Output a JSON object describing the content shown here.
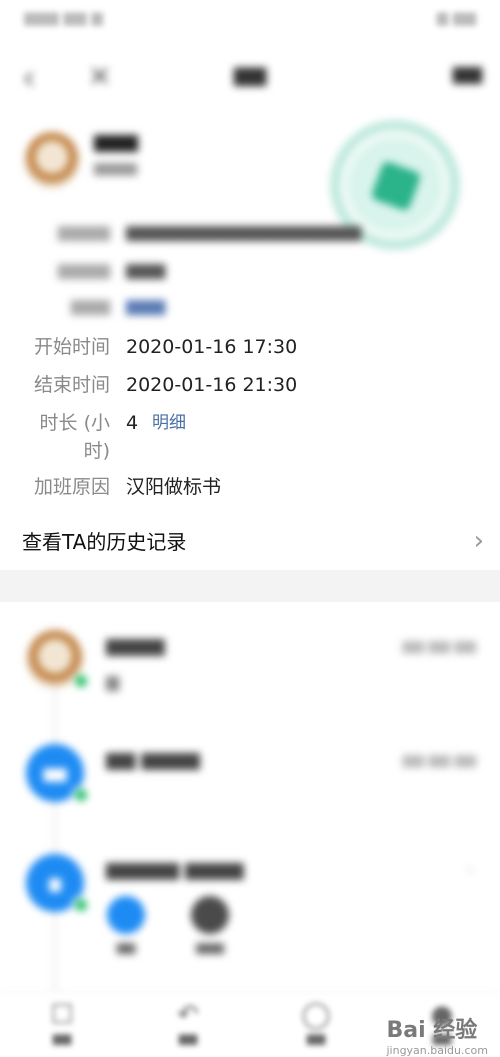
{
  "detail": {
    "start_label": "开始时间",
    "start_value": "2020-01-16 17:30",
    "end_label": "结束时间",
    "end_value": "2020-01-16 21:30",
    "duration_label_line1": "时长 (小",
    "duration_label_line2": "时)",
    "duration_value": "4",
    "duration_link": "明细",
    "reason_label": "加班原因",
    "reason_value": "汉阳做标书"
  },
  "history": {
    "label": "查看TA的历史记录"
  },
  "watermark": {
    "brand": "Bai 经验",
    "url": "jingyan.baidu.com"
  },
  "icons": [
    "back-icon",
    "close-icon",
    "chevron-right-icon",
    "check-icon"
  ]
}
